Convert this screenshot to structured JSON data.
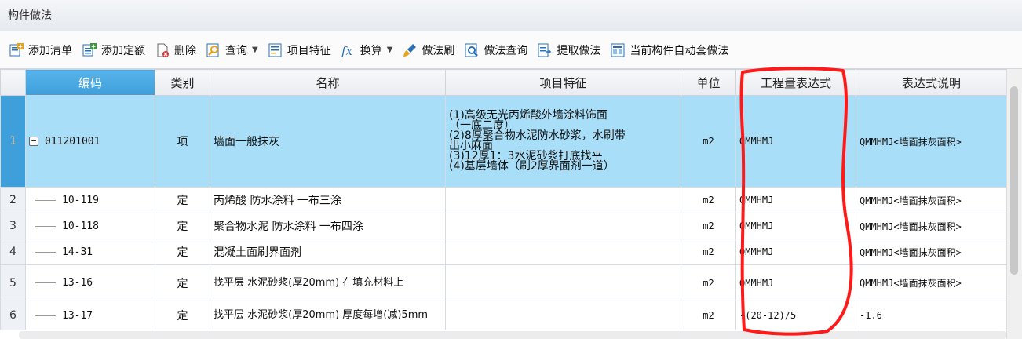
{
  "panel": {
    "title": "构件做法"
  },
  "toolbar": {
    "items": [
      {
        "label": "添加清单",
        "icon": "add-list-icon"
      },
      {
        "label": "添加定额",
        "icon": "add-quota-icon"
      },
      {
        "label": "删除",
        "icon": "delete-icon"
      },
      {
        "label": "查询",
        "icon": "search-icon",
        "dropdown": true
      },
      {
        "label": "项目特征",
        "icon": "feature-icon"
      },
      {
        "label": "换算",
        "icon": "fx-icon",
        "dropdown": true
      },
      {
        "label": "做法刷",
        "icon": "brush-icon"
      },
      {
        "label": "做法查询",
        "icon": "method-search-icon"
      },
      {
        "label": "提取做法",
        "icon": "extract-icon"
      },
      {
        "label": "当前构件自动套做法",
        "icon": "auto-apply-icon"
      }
    ]
  },
  "table": {
    "headers": [
      "编码",
      "类别",
      "名称",
      "项目特征",
      "单位",
      "工程量表达式",
      "表达式说明"
    ],
    "rows": [
      {
        "num": "1",
        "code": "011201001",
        "type": "项",
        "name": "墙面一般抹灰",
        "feature": "(1)高级无光丙烯酸外墙涂料饰面\n（一底二度）\n(2)8厚聚合物水泥防水砂浆，水刷带\n出小麻面\n(3)12厚1：3水泥砂浆打底找平\n(4)基层墙体（刷2厚界面剂一道）",
        "unit": "m2",
        "expr": "QMMHMJ",
        "desc": "QMMHMJ<墙面抹灰面积>"
      },
      {
        "num": "2",
        "code": "10-119",
        "type": "定",
        "name": "丙烯酸 防水涂料 一布三涂",
        "feature": "",
        "unit": "m2",
        "expr": "QMMHMJ",
        "desc": "QMMHMJ<墙面抹灰面积>"
      },
      {
        "num": "3",
        "code": "10-118",
        "type": "定",
        "name": "聚合物水泥 防水涂料 一布四涂",
        "feature": "",
        "unit": "m2",
        "expr": "QMMHMJ",
        "desc": "QMMHMJ<墙面抹灰面积>"
      },
      {
        "num": "4",
        "code": "14-31",
        "type": "定",
        "name": "混凝土面刷界面剂",
        "feature": "",
        "unit": "m2",
        "expr": "QMMHMJ",
        "desc": "QMMHMJ<墙面抹灰面积>"
      },
      {
        "num": "5",
        "code": "13-16",
        "type": "定",
        "name": "找平层 水泥砂浆(厚20mm) 在填充材料上",
        "feature": "",
        "unit": "m2",
        "expr": "QMMHMJ",
        "desc": "QMMHMJ<墙面抹灰面积>"
      },
      {
        "num": "6",
        "code": "13-17",
        "type": "定",
        "name": "找平层 水泥砂浆(厚20mm) 厚度每增(减)5mm",
        "feature": "",
        "unit": "m2",
        "expr": "-(20-12)/5",
        "desc": "-1.6"
      }
    ]
  },
  "colors": {
    "selected_row": "#a9def8",
    "header_accent": "#3f9fdb",
    "annotation": "#ff1a1a"
  }
}
